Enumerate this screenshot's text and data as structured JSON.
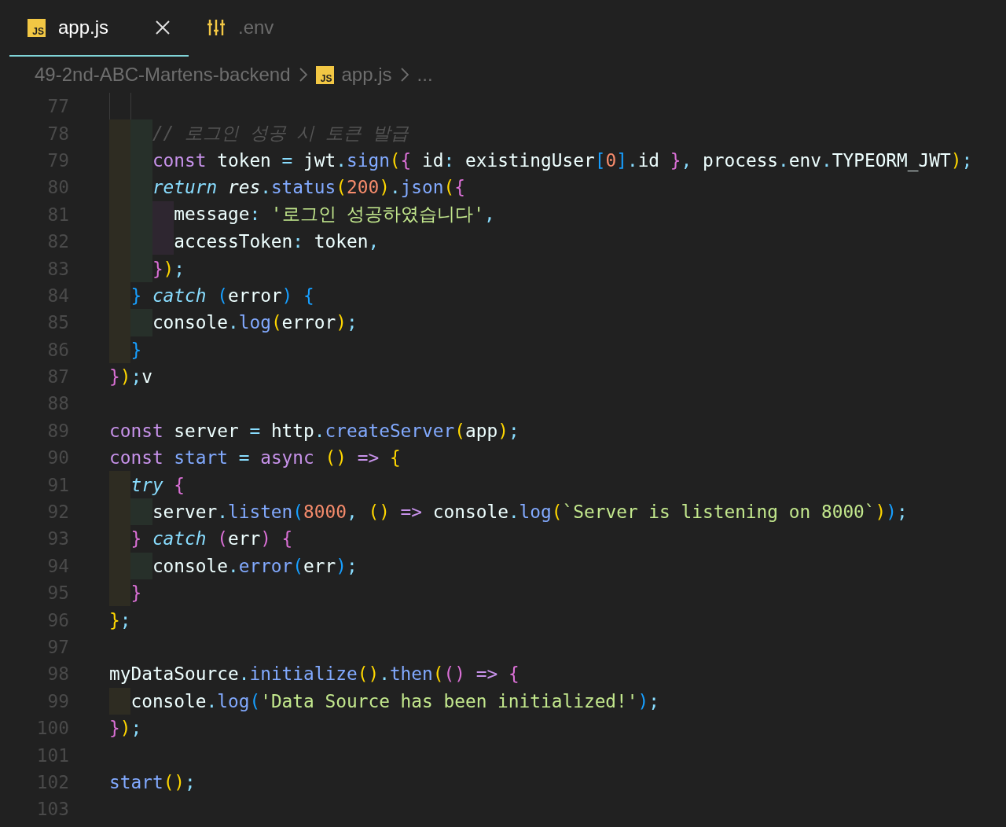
{
  "tabs": [
    {
      "label": "app.js",
      "kind": "js",
      "icon_text": "JS",
      "selected": true
    },
    {
      "label": ".env",
      "kind": "settings",
      "selected": false
    }
  ],
  "breadcrumb": [
    {
      "label": "49-2nd-ABC-Martens-backend",
      "kind": "folder"
    },
    {
      "label": "app.js",
      "kind": "js",
      "icon_text": "JS"
    },
    {
      "label": "...",
      "kind": "more"
    }
  ],
  "lines": [
    {
      "number": "77",
      "guides": true
    },
    {
      "number": "78",
      "tokens": [
        {
          "text": "    // 로그인 성공 시 토큰 발급",
          "kind": "cm"
        }
      ]
    },
    {
      "number": "79",
      "tokens": [
        {
          "text": "    const",
          "kind": "kw"
        },
        {
          "text": " token ",
          "kind": "pl"
        },
        {
          "text": "=",
          "kind": "op"
        },
        {
          "text": " jwt",
          "kind": "pl"
        },
        {
          "text": ".",
          "kind": "op"
        },
        {
          "text": "sign",
          "kind": "fn"
        },
        {
          "text": "(",
          "kind": "b1"
        },
        {
          "text": "{",
          "kind": "b2"
        },
        {
          "text": " id",
          "kind": "pl"
        },
        {
          "text": ":",
          "kind": "op"
        },
        {
          "text": " existingUser",
          "kind": "pl"
        },
        {
          "text": "[",
          "kind": "b3"
        },
        {
          "text": "0",
          "kind": "num"
        },
        {
          "text": "]",
          "kind": "b3"
        },
        {
          "text": ".",
          "kind": "op"
        },
        {
          "text": "id ",
          "kind": "pl"
        },
        {
          "text": "}",
          "kind": "b2"
        },
        {
          "text": ",",
          "kind": "op"
        },
        {
          "text": " process",
          "kind": "pl"
        },
        {
          "text": ".",
          "kind": "op"
        },
        {
          "text": "env",
          "kind": "pl"
        },
        {
          "text": ".",
          "kind": "op"
        },
        {
          "text": "TYPEORM_JWT",
          "kind": "pl"
        },
        {
          "text": ")",
          "kind": "b1"
        },
        {
          "text": ";",
          "kind": "op"
        }
      ]
    },
    {
      "number": "80",
      "tokens": [
        {
          "text": "    return ",
          "kind": "kwi"
        },
        {
          "text": "res",
          "kind": "vr"
        },
        {
          "text": ".",
          "kind": "op"
        },
        {
          "text": "status",
          "kind": "fn"
        },
        {
          "text": "(",
          "kind": "b1"
        },
        {
          "text": "200",
          "kind": "num"
        },
        {
          "text": ")",
          "kind": "b1"
        },
        {
          "text": ".",
          "kind": "op"
        },
        {
          "text": "json",
          "kind": "fn"
        },
        {
          "text": "(",
          "kind": "b1"
        },
        {
          "text": "{",
          "kind": "b2"
        }
      ]
    },
    {
      "number": "81",
      "tokens": [
        {
          "text": "      message",
          "kind": "pl"
        },
        {
          "text": ": ",
          "kind": "op"
        },
        {
          "text": "'로그인 성공하였습니다'",
          "kind": "str"
        },
        {
          "text": ",",
          "kind": "op"
        }
      ]
    },
    {
      "number": "82",
      "tokens": [
        {
          "text": "      accessToken",
          "kind": "pl"
        },
        {
          "text": ":",
          "kind": "op"
        },
        {
          "text": " token",
          "kind": "pl"
        },
        {
          "text": ",",
          "kind": "op"
        }
      ]
    },
    {
      "number": "83",
      "tokens": [
        {
          "text": "    }",
          "kind": "b2"
        },
        {
          "text": ")",
          "kind": "b1"
        },
        {
          "text": ";",
          "kind": "op"
        }
      ]
    },
    {
      "number": "84",
      "tokens": [
        {
          "text": "  } ",
          "kind": "b3"
        },
        {
          "text": "catch ",
          "kind": "kwi"
        },
        {
          "text": "(",
          "kind": "b3"
        },
        {
          "text": "error",
          "kind": "pl"
        },
        {
          "text": ") {",
          "kind": "b3"
        }
      ]
    },
    {
      "number": "85",
      "tokens": [
        {
          "text": "    console",
          "kind": "pl"
        },
        {
          "text": ".",
          "kind": "op"
        },
        {
          "text": "log",
          "kind": "fn"
        },
        {
          "text": "(",
          "kind": "b1"
        },
        {
          "text": "error",
          "kind": "pl"
        },
        {
          "text": ")",
          "kind": "b1"
        },
        {
          "text": ";",
          "kind": "op"
        }
      ]
    },
    {
      "number": "86",
      "tokens": [
        {
          "text": "  }",
          "kind": "b3"
        }
      ]
    },
    {
      "number": "87",
      "tokens": [
        {
          "text": "}",
          "kind": "b2"
        },
        {
          "text": ")",
          "kind": "b1"
        },
        {
          "text": ";",
          "kind": "op"
        },
        {
          "text": "v",
          "kind": "pl"
        }
      ]
    },
    {
      "number": "88"
    },
    {
      "number": "89",
      "tokens": [
        {
          "text": "const",
          "kind": "kw"
        },
        {
          "text": " server ",
          "kind": "pl"
        },
        {
          "text": "=",
          "kind": "op"
        },
        {
          "text": " http",
          "kind": "pl"
        },
        {
          "text": ".",
          "kind": "op"
        },
        {
          "text": "createServer",
          "kind": "fn"
        },
        {
          "text": "(",
          "kind": "b1"
        },
        {
          "text": "app",
          "kind": "pl"
        },
        {
          "text": ")",
          "kind": "b1"
        },
        {
          "text": ";",
          "kind": "op"
        }
      ]
    },
    {
      "number": "90",
      "tokens": [
        {
          "text": "const ",
          "kind": "kw"
        },
        {
          "text": "start ",
          "kind": "fn"
        },
        {
          "text": "= ",
          "kind": "op"
        },
        {
          "text": "async ",
          "kind": "kw"
        },
        {
          "text": "() ",
          "kind": "b1"
        },
        {
          "text": "=> ",
          "kind": "kw"
        },
        {
          "text": "{",
          "kind": "b1"
        }
      ]
    },
    {
      "number": "91",
      "tokens": [
        {
          "text": "  try ",
          "kind": "kwi"
        },
        {
          "text": "{",
          "kind": "b2"
        }
      ]
    },
    {
      "number": "92",
      "tokens": [
        {
          "text": "    server",
          "kind": "pl"
        },
        {
          "text": ".",
          "kind": "op"
        },
        {
          "text": "listen",
          "kind": "fn"
        },
        {
          "text": "(",
          "kind": "b3"
        },
        {
          "text": "8000",
          "kind": "num"
        },
        {
          "text": ", ",
          "kind": "op"
        },
        {
          "text": "() ",
          "kind": "b1"
        },
        {
          "text": "=>",
          "kind": "kw"
        },
        {
          "text": " console",
          "kind": "pl"
        },
        {
          "text": ".",
          "kind": "op"
        },
        {
          "text": "log",
          "kind": "fn"
        },
        {
          "text": "(",
          "kind": "b1"
        },
        {
          "text": "`Server is listening on 8000`",
          "kind": "str"
        },
        {
          "text": ")",
          "kind": "b1"
        },
        {
          "text": ")",
          "kind": "b3"
        },
        {
          "text": ";",
          "kind": "op"
        }
      ]
    },
    {
      "number": "93",
      "tokens": [
        {
          "text": "  } ",
          "kind": "b2"
        },
        {
          "text": "catch ",
          "kind": "kwi"
        },
        {
          "text": "(",
          "kind": "b2"
        },
        {
          "text": "err",
          "kind": "pl"
        },
        {
          "text": ") {",
          "kind": "b2"
        }
      ]
    },
    {
      "number": "94",
      "tokens": [
        {
          "text": "    console",
          "kind": "pl"
        },
        {
          "text": ".",
          "kind": "op"
        },
        {
          "text": "error",
          "kind": "fn"
        },
        {
          "text": "(",
          "kind": "b3"
        },
        {
          "text": "err",
          "kind": "pl"
        },
        {
          "text": ")",
          "kind": "b3"
        },
        {
          "text": ";",
          "kind": "op"
        }
      ]
    },
    {
      "number": "95",
      "tokens": [
        {
          "text": "  }",
          "kind": "b2"
        }
      ]
    },
    {
      "number": "96",
      "tokens": [
        {
          "text": "}",
          "kind": "b1"
        },
        {
          "text": ";",
          "kind": "op"
        }
      ]
    },
    {
      "number": "97"
    },
    {
      "number": "98",
      "tokens": [
        {
          "text": "myDataSource",
          "kind": "pl"
        },
        {
          "text": ".",
          "kind": "op"
        },
        {
          "text": "initialize",
          "kind": "fn"
        },
        {
          "text": "()",
          "kind": "b1"
        },
        {
          "text": ".",
          "kind": "op"
        },
        {
          "text": "then",
          "kind": "fn"
        },
        {
          "text": "(",
          "kind": "b1"
        },
        {
          "text": "() ",
          "kind": "b2"
        },
        {
          "text": "=> ",
          "kind": "kw"
        },
        {
          "text": "{",
          "kind": "b2"
        }
      ]
    },
    {
      "number": "99",
      "tokens": [
        {
          "text": "  console",
          "kind": "pl"
        },
        {
          "text": ".",
          "kind": "op"
        },
        {
          "text": "log",
          "kind": "fn"
        },
        {
          "text": "(",
          "kind": "b3"
        },
        {
          "text": "'Data Source has been initialized!'",
          "kind": "str"
        },
        {
          "text": ")",
          "kind": "b3"
        },
        {
          "text": ";",
          "kind": "op"
        }
      ]
    },
    {
      "number": "100",
      "tokens": [
        {
          "text": "}",
          "kind": "b2"
        },
        {
          "text": ")",
          "kind": "b1"
        },
        {
          "text": ";",
          "kind": "op"
        }
      ]
    },
    {
      "number": "101"
    },
    {
      "number": "102",
      "tokens": [
        {
          "text": "start",
          "kind": "fn"
        },
        {
          "text": "()",
          "kind": "b1"
        },
        {
          "text": ";",
          "kind": "op"
        }
      ]
    },
    {
      "number": "103"
    }
  ]
}
